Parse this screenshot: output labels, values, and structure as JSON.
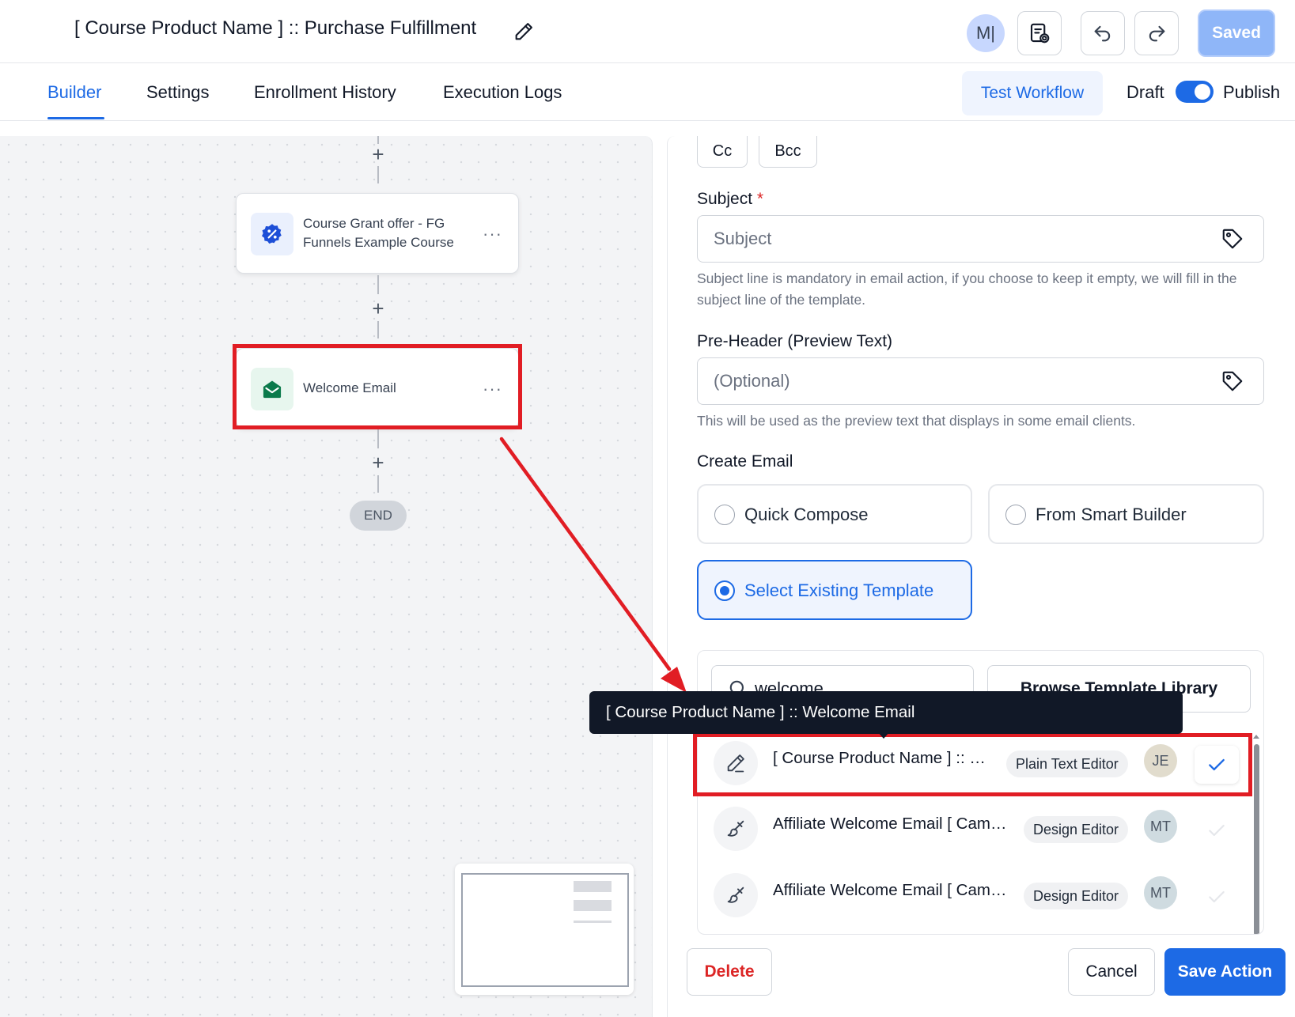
{
  "header": {
    "workflow_title": "[ Course Product Name ] :: Purchase Fulfillment",
    "user_initials": "M|",
    "saved_label": "Saved"
  },
  "tabs": [
    {
      "label": "Builder",
      "active": true
    },
    {
      "label": "Settings",
      "active": false
    },
    {
      "label": "Enrollment History",
      "active": false
    },
    {
      "label": "Execution Logs",
      "active": false
    }
  ],
  "toolbar": {
    "test_workflow_label": "Test Workflow",
    "draft_label": "Draft",
    "publish_label": "Publish",
    "publish_toggle_on": true
  },
  "canvas": {
    "nodes": [
      {
        "title": "Course Grant offer - FG Funnels Example Course",
        "line1": "Course Grant offer - FG",
        "line2": "Funnels Example Course",
        "icon": "percent-badge-icon",
        "menu": "···"
      },
      {
        "title": "Welcome Email",
        "icon": "email-open-icon",
        "menu": "···"
      }
    ],
    "plus_symbol": "+",
    "end_label": "END"
  },
  "panel": {
    "cc_label": "Cc",
    "bcc_label": "Bcc",
    "subject": {
      "label": "Subject",
      "required_mark": "*",
      "value": "",
      "placeholder": "Subject",
      "help": "Subject line is mandatory in email action, if you choose to keep it empty, we will fill in the subject line of the template."
    },
    "preheader": {
      "label": "Pre-Header (Preview Text)",
      "value": "",
      "placeholder": "(Optional)",
      "help": "This will be used as the preview text that displays in some email clients."
    },
    "create_email": {
      "label": "Create Email",
      "options": [
        {
          "label": "Quick Compose",
          "selected": false
        },
        {
          "label": "From Smart Builder",
          "selected": false
        },
        {
          "label": "Select Existing Template",
          "selected": true
        }
      ]
    },
    "template_search": {
      "value": "welcome",
      "placeholder": "Search"
    },
    "browse_label": "Browse Template Library",
    "templates": [
      {
        "name": "[ Course Product Name ] :: Welcome Email",
        "editor": "Plain Text Editor",
        "author_initials": "JE",
        "avatar_color": "#e1dccd",
        "selected": true,
        "icon": "pencil-icon"
      },
      {
        "name": "Affiliate Welcome Email [ Campaign ]",
        "editor": "Design Editor",
        "author_initials": "MT",
        "avatar_color": "#cfdbe0",
        "selected": false,
        "icon": "brush-icon"
      },
      {
        "name": "Affiliate Welcome Email [ Campaign ]",
        "editor": "Design Editor",
        "author_initials": "MT",
        "avatar_color": "#cfdbe0",
        "selected": false,
        "icon": "brush-icon"
      }
    ],
    "tooltip": "[ Course Product Name ] :: Welcome Email",
    "delete_label": "Delete",
    "cancel_label": "Cancel",
    "save_action_label": "Save Action"
  },
  "colors": {
    "accent": "#1d6ae5",
    "annotation_red": "#e11d24",
    "danger": "#dc2626"
  }
}
